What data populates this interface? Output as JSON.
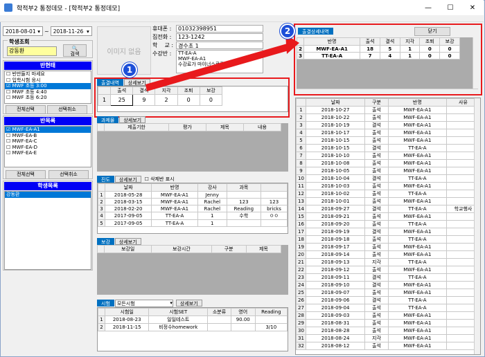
{
  "window": {
    "title": "학적부2 통정데모 - [학적부2 통정데모]",
    "min": "—",
    "max": "☐",
    "close": "✕"
  },
  "dates": {
    "from": "2018-08-01",
    "sep": "~",
    "to": "2018-11-26"
  },
  "student_search": {
    "title": "학생조회",
    "value": "강동환",
    "button": "검색"
  },
  "classes": {
    "title": "반현태",
    "items": [
      "반만들지 마세요",
      "입학시험 응시",
      "MWF 초등 3:00",
      "MWF 초등 4:40",
      "MWF 초등 6:20"
    ],
    "select_all": "전체선택",
    "deselect": "선택취소"
  },
  "class_list": {
    "title": "반목록",
    "items": [
      "MWF-EA-A1",
      "MWF-EA-B",
      "MWF-EA-C",
      "MWF-EA-D",
      "MWF-EA-E"
    ],
    "select_all": "전체선택",
    "deselect": "선택취소"
  },
  "students": {
    "title": "학생목록",
    "items": [
      "강동환"
    ]
  },
  "photo": {
    "text": "이미지 없음"
  },
  "info": {
    "labels": [
      "휴대폰 :",
      "집전화 :",
      "학    교 :",
      "수강반 :"
    ],
    "values": [
      "01032398951",
      "123-1242",
      "경수초 1",
      "TT-EA-A\nMWF-EA-A1\n수강료가 마이너스로록인만"
    ]
  },
  "attendance": {
    "tab": "출결내역",
    "detail": "상세보기",
    "headers": [
      "출석",
      "결석",
      "지각",
      "조퇴",
      "보강"
    ],
    "row": [
      "1",
      "25",
      "9",
      "2",
      "0",
      "0"
    ]
  },
  "attendance_detail": {
    "tab": "출결상세내역",
    "close": "닫기",
    "headers": [
      "반명",
      "출석",
      "결석",
      "지각",
      "조퇴",
      "보강"
    ],
    "rows": [
      [
        "2",
        "MWF-EA-A1",
        "18",
        "5",
        "1",
        "0",
        "0"
      ],
      [
        "3",
        "TT-EA-A",
        "7",
        "4",
        "1",
        "0",
        "0"
      ]
    ]
  },
  "homework": {
    "tab": "과제물",
    "detail": "상세보기",
    "headers": [
      "제출기한",
      "평가",
      "제목",
      "내용"
    ]
  },
  "progress": {
    "tab": "진도",
    "detail": "상세보기",
    "check": "삭제반 표시",
    "headers": [
      "날짜",
      "반명",
      "강사",
      "과목",
      ""
    ],
    "rows": [
      [
        "1",
        "2018-05-28",
        "MWF-EA-A1",
        "Jenny",
        "",
        ""
      ],
      [
        "2",
        "2018-03-15",
        "MWF-EA-A1",
        "Rachel",
        "123",
        "123"
      ],
      [
        "3",
        "2018-02-20",
        "MWF-EA-A1",
        "Rachel",
        "Reading",
        "bricks"
      ],
      [
        "4",
        "2017-09-05",
        "TT-EA-A",
        "1",
        "수학",
        "ㅇㅇ"
      ],
      [
        "5",
        "2017-09-05",
        "TT-EA-A",
        "1",
        "",
        ""
      ]
    ]
  },
  "makeup": {
    "tab": "보강",
    "detail": "상세보기",
    "headers": [
      "보강일",
      "보강시간",
      "구분",
      "제목"
    ]
  },
  "exam": {
    "tab": "시험",
    "select": "모든시험",
    "detail": "상세보기",
    "headers": [
      "시험일",
      "시험SET",
      "소분류",
      "영어",
      "Reading"
    ],
    "rows": [
      [
        "1",
        "2018-08-23",
        "일일테스트",
        "",
        "90.00",
        ""
      ],
      [
        "2",
        "2018-11-15",
        "비정수homework",
        "",
        "",
        "3/10"
      ]
    ]
  },
  "att_list": {
    "headers": [
      "날짜",
      "구분",
      "반명",
      "사유"
    ],
    "rows": [
      [
        "1",
        "2018-10-27",
        "출석",
        "MWF-EA-A1",
        ""
      ],
      [
        "2",
        "2018-10-22",
        "출석",
        "MWF-EA-A1",
        ""
      ],
      [
        "3",
        "2018-10-19",
        "결석",
        "MWF-EA-A1",
        ""
      ],
      [
        "4",
        "2018-10-17",
        "출석",
        "MWF-EA-A1",
        ""
      ],
      [
        "5",
        "2018-10-15",
        "출석",
        "MWF-EA-A1",
        ""
      ],
      [
        "6",
        "2018-10-15",
        "결석",
        "TT-EA-A",
        ""
      ],
      [
        "7",
        "2018-10-10",
        "출석",
        "MWF-EA-A1",
        ""
      ],
      [
        "8",
        "2018-10-08",
        "출석",
        "MWF-EA-A1",
        ""
      ],
      [
        "9",
        "2018-10-05",
        "출석",
        "MWF-EA-A1",
        ""
      ],
      [
        "10",
        "2018-10-04",
        "결석",
        "TT-EA-A",
        ""
      ],
      [
        "11",
        "2018-10-03",
        "출석",
        "MWF-EA-A1",
        ""
      ],
      [
        "12",
        "2018-10-02",
        "출석",
        "TT-EA-A",
        ""
      ],
      [
        "13",
        "2018-10-01",
        "출석",
        "MWF-EA-A1",
        ""
      ],
      [
        "14",
        "2018-09-27",
        "결석",
        "TT-EA-A",
        "학교행사"
      ],
      [
        "15",
        "2018-09-21",
        "출석",
        "MWF-EA-A1",
        ""
      ],
      [
        "16",
        "2018-09-20",
        "출석",
        "TT-EA-A",
        ""
      ],
      [
        "17",
        "2018-09-19",
        "결석",
        "MWF-EA-A1",
        ""
      ],
      [
        "18",
        "2018-09-18",
        "출석",
        "TT-EA-A",
        ""
      ],
      [
        "19",
        "2018-09-17",
        "출석",
        "MWF-EA-A1",
        ""
      ],
      [
        "20",
        "2018-09-14",
        "출석",
        "MWF-EA-A1",
        ""
      ],
      [
        "21",
        "2018-09-13",
        "지각",
        "TT-EA-A",
        ""
      ],
      [
        "22",
        "2018-09-12",
        "출석",
        "MWF-EA-A1",
        ""
      ],
      [
        "23",
        "2018-09-11",
        "결석",
        "TT-EA-A",
        ""
      ],
      [
        "24",
        "2018-09-10",
        "결석",
        "MWF-EA-A1",
        ""
      ],
      [
        "25",
        "2018-09-07",
        "출석",
        "MWF-EA-A1",
        ""
      ],
      [
        "26",
        "2018-09-06",
        "결석",
        "TT-EA-A",
        ""
      ],
      [
        "27",
        "2018-09-04",
        "출석",
        "TT-EA-A",
        ""
      ],
      [
        "28",
        "2018-09-03",
        "출석",
        "MWF-EA-A1",
        ""
      ],
      [
        "29",
        "2018-08-31",
        "출석",
        "MWF-EA-A1",
        ""
      ],
      [
        "30",
        "2018-08-28",
        "출석",
        "MWF-EA-A1",
        ""
      ],
      [
        "31",
        "2018-08-24",
        "지각",
        "MWF-EA-A1",
        ""
      ],
      [
        "32",
        "2018-08-12",
        "출석",
        "MWF-EA-A1",
        ""
      ]
    ]
  },
  "callouts": [
    "1",
    "2"
  ]
}
